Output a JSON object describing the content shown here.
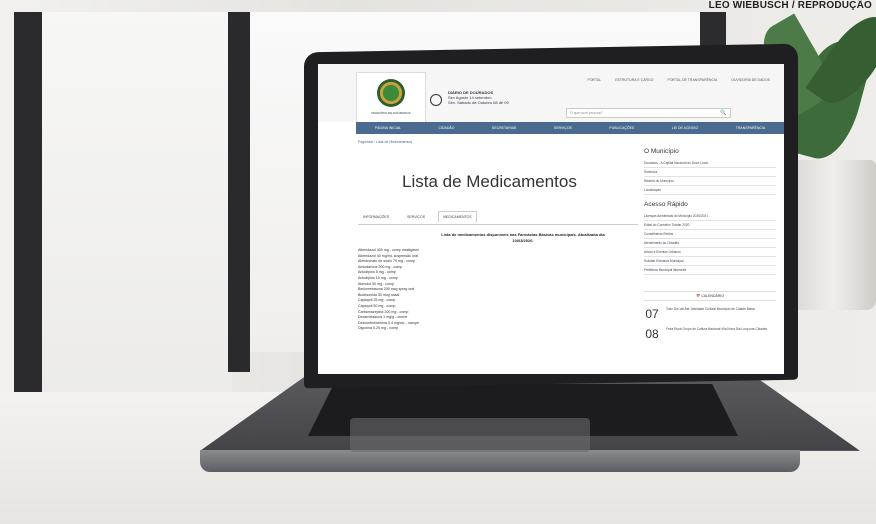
{
  "credit": "LEO WIEBUSCH / REPRODUÇÃO",
  "site": {
    "diario": [
      "DIÁRIO DE DOURADOS",
      "Sex Agosto 14 setembro",
      "Sex. Sábado da Outubro 08 de 09"
    ],
    "top_links": [
      "PORTAL",
      "ESTRUTURA E CARGO",
      "PORTAL DE TRANSPARÊNCIA",
      "OUVIDORIA DE DADOS"
    ],
    "search_placeholder": "O que você procura?",
    "logo_text": "MUNICÍPIO DE DOURADOS",
    "nav": [
      "PÁGINA INICIAL",
      "CIDADÃO",
      "SECRETARIAS",
      "SERVIÇOS",
      "PUBLICAÇÕES",
      "LEI DE ACESSO",
      "TRANSPARÊNCIA"
    ],
    "breadcrumb": "Paginicial › Lista de Medicamentos",
    "title": "Lista de Medicamentos",
    "tabs": [
      "INFORMAÇÕES",
      "SERVIÇOS",
      "MEDICAMENTOS"
    ],
    "intro": "Lista de medicamentos disponíveis nas Farmácias Básicas municipais. Atualizada dia 10/03/2020.",
    "medicines": [
      "Albendazol 400 mg - comp mastigável",
      "Albendazol 40 mg/mL suspensão oral",
      "Alendronato de sódio 70 mg - comp",
      "Amiodarona 200 mg - comp",
      "Anlodipino 5 mg - comp",
      "Anlodipino 10 mg - comp",
      "Atenolol 50 mg - comp",
      "Beclometasona 200 mcg spray oral",
      "Budesonida 50 mcg nasal",
      "Captopril 25 mg - comp",
      "Captopril 50 mg - comp",
      "Carbamazepina 200 mg - comp",
      "Dexametasona 1 mg/g - creme",
      "Dexclorfeniramina 0,4 mg/mL - xarope",
      "Digoxina 0,25 mg - comp"
    ],
    "sidebar": {
      "municipio_title": "O Município",
      "municipio_items": [
        "Dourados - A Capital Nacional do Doce Local",
        "Símbolos",
        "História do Município",
        "Localização"
      ],
      "acesso_title": "Acesso Rápido",
      "acesso_items": [
        "Licenças Ambientais do Município 2020/2021",
        "Edital do Conselho Tutelar 2020",
        "Conselheiros Eleitos",
        "Atendimento ao Cidadão",
        "Ativos e Eventos Urbanos",
        "Solicitar Estrutura Municipal",
        "Prefeitura Municipal Itinerante"
      ],
      "calendar_title": "CALENDÁRIO",
      "events": [
        {
          "day": "07",
          "text": "Todo Dia Vai Até: Atividade Cultural Município de Cidade Baixa"
        },
        {
          "day": "08",
          "text": "Feira Rural Grupo de Cultura Nacional Vila Nova Dia Loop nas Cidades"
        }
      ]
    }
  },
  "colors": {
    "nav": "#4a6a90",
    "frame": "#2b2b2d",
    "laptop": "#1f1f21"
  }
}
